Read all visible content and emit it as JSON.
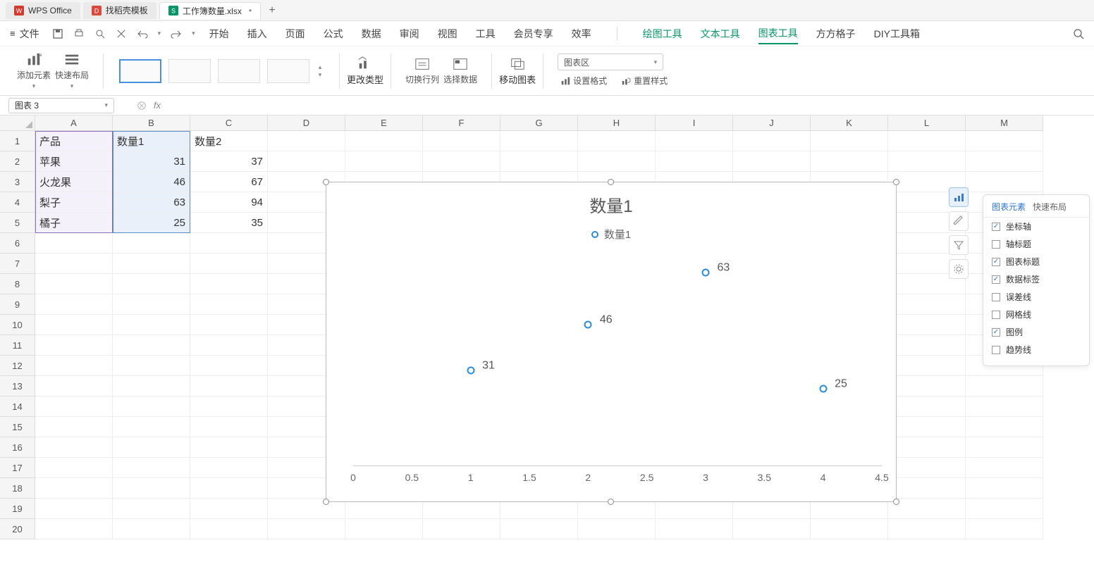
{
  "top_tabs": {
    "items": [
      {
        "label": "WPS Office",
        "icon_color": "#d23b2f"
      },
      {
        "label": "找稻壳模板",
        "icon_color": "#d84a3e"
      },
      {
        "label": "工作簿数量.xlsx",
        "icon_color": "#0a9469",
        "active": true,
        "modified": "•"
      }
    ],
    "add": "+"
  },
  "menu": {
    "file_label": "文件",
    "tabs": [
      "开始",
      "插入",
      "页面",
      "公式",
      "数据",
      "审阅",
      "视图",
      "工具",
      "会员专享",
      "效率"
    ],
    "green_tabs": [
      "绘图工具",
      "文本工具",
      "图表工具"
    ],
    "extra_tabs": [
      "方方格子",
      "DIY工具箱"
    ],
    "active_green": "图表工具"
  },
  "ribbon": {
    "add_element": "添加元素",
    "quick_layout": "快速布局",
    "change_type": "更改类型",
    "switch_rowcol": "切换行列",
    "select_data": "选择数据",
    "move_chart": "移动图表",
    "area_select": "图表区",
    "set_format": "设置格式",
    "reset_style": "重置样式"
  },
  "formula_bar": {
    "name_box": "图表 3",
    "fx": "fx"
  },
  "columns": [
    "A",
    "B",
    "C",
    "D",
    "E",
    "F",
    "G",
    "H",
    "I",
    "J",
    "K",
    "L",
    "M"
  ],
  "rows": 20,
  "sheet_data": {
    "A1": "产品",
    "B1": "数量1",
    "C1": "数量2",
    "A2": "苹果",
    "B2": "31",
    "C2": "37",
    "A3": "火龙果",
    "B3": "46",
    "C3": "67",
    "A4": "梨子",
    "B4": "63",
    "C4": "94",
    "A5": "橘子",
    "B5": "25",
    "C5": "35"
  },
  "chart_data": {
    "type": "scatter",
    "title": "数量1",
    "legend": [
      "数量1"
    ],
    "series": [
      {
        "name": "数量1",
        "x": [
          1,
          2,
          3,
          4
        ],
        "y": [
          31,
          46,
          63,
          25
        ]
      }
    ],
    "xlim": [
      0,
      4.5
    ],
    "x_ticks": [
      0,
      0.5,
      1,
      1.5,
      2,
      2.5,
      3,
      3.5,
      4,
      4.5
    ],
    "data_labels": true
  },
  "panel": {
    "tabs": [
      "图表元素",
      "快速布局"
    ],
    "active_tab": "图表元素",
    "items": [
      {
        "label": "坐标轴",
        "checked": true
      },
      {
        "label": "轴标题",
        "checked": false
      },
      {
        "label": "图表标题",
        "checked": true
      },
      {
        "label": "数据标签",
        "checked": true
      },
      {
        "label": "误差线",
        "checked": false
      },
      {
        "label": "网格线",
        "checked": false
      },
      {
        "label": "图例",
        "checked": true
      },
      {
        "label": "趋势线",
        "checked": false
      }
    ]
  }
}
